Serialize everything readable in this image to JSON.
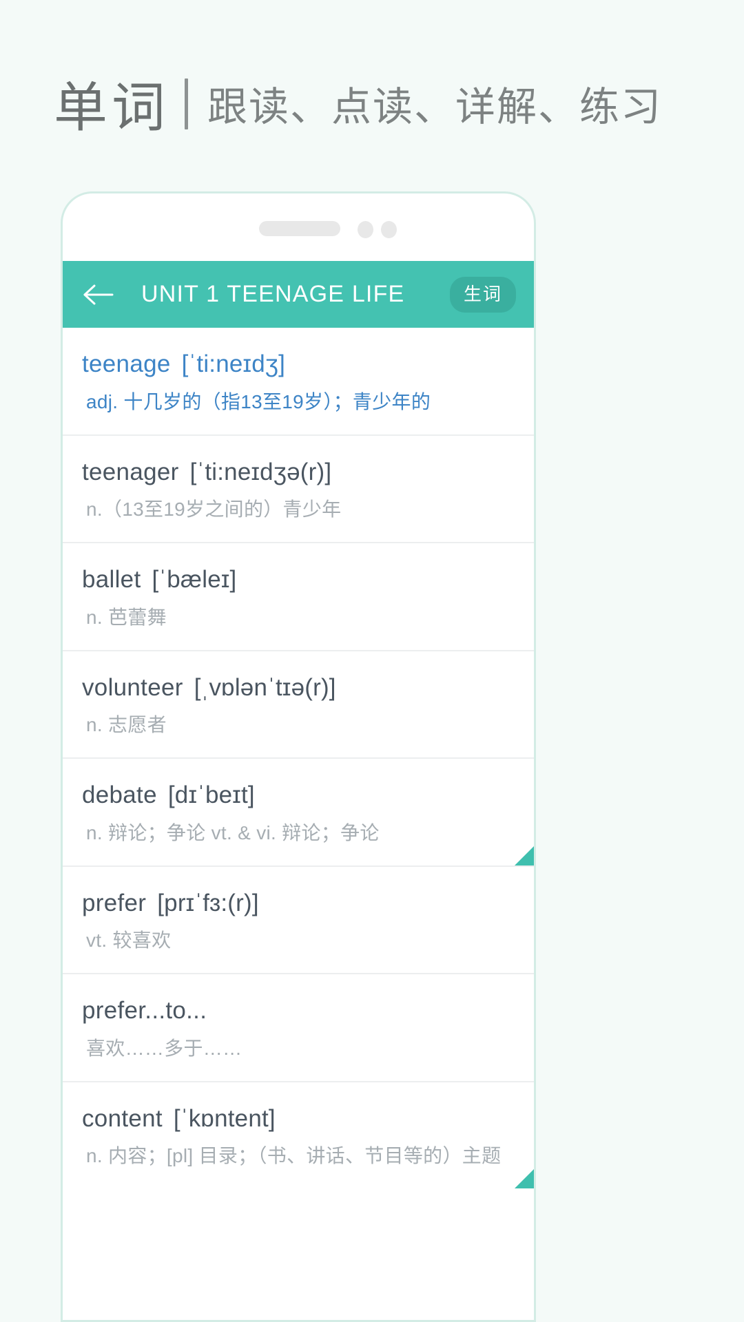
{
  "heading": {
    "main": "单词",
    "sub": "跟读、点读、详解、练习"
  },
  "colors": {
    "page_bg": "#f4faf8",
    "accent_teal": "#44c2b1",
    "badge_teal": "#3aaf9f",
    "highlight_blue": "#3d84c6",
    "word_text": "#4a5560",
    "def_text": "#a6adb2",
    "flag_teal": "#3fbfae"
  },
  "appbar": {
    "back_icon": "arrow-left-icon",
    "title": "UNIT 1 TEENAGE LIFE",
    "badge_label": "生词"
  },
  "words": [
    {
      "term": "teenage",
      "phonetic": "[ˈti:neɪdʒ]",
      "definition": "adj. 十几岁的（指13至19岁）；青少年的",
      "highlighted": true,
      "flag": false
    },
    {
      "term": "teenager",
      "phonetic": "[ˈti:neɪdʒə(r)]",
      "definition": "n.（13至19岁之间的）青少年",
      "highlighted": false,
      "flag": false
    },
    {
      "term": "ballet",
      "phonetic": "[ˈbæleɪ]",
      "definition": "n. 芭蕾舞",
      "highlighted": false,
      "flag": false
    },
    {
      "term": "volunteer",
      "phonetic": "[ˌvɒlənˈtɪə(r)]",
      "definition": "n. 志愿者",
      "highlighted": false,
      "flag": false
    },
    {
      "term": "debate",
      "phonetic": "[dɪˈbeɪt]",
      "definition": "n. 辩论；争论 vt. & vi. 辩论；争论",
      "highlighted": false,
      "flag": true
    },
    {
      "term": "prefer",
      "phonetic": "[prɪˈfɜ:(r)]",
      "definition": "vt. 较喜欢",
      "highlighted": false,
      "flag": false
    },
    {
      "term": "prefer...to...",
      "phonetic": "",
      "definition": "喜欢……多于……",
      "highlighted": false,
      "flag": false
    },
    {
      "term": "content",
      "phonetic": "[ˈkɒntent]",
      "definition": "n. 内容；[pl] 目录；（书、讲话、节目等的）主题",
      "highlighted": false,
      "flag": true
    }
  ]
}
